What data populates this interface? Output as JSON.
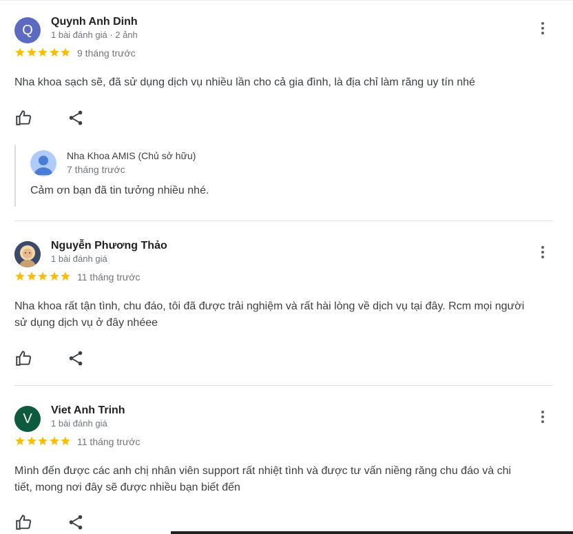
{
  "reviews": [
    {
      "avatar_letter": "Q",
      "avatar_color": "#5c6bc0",
      "name": "Quynh Anh Dinh",
      "meta": "1 bài đánh giá · 2 ảnh",
      "rating": 5,
      "time": "9 tháng trước",
      "text": "Nha khoa sạch sẽ, đã sử dụng dịch vụ nhiều lần cho cả gia đình, là địa chỉ làm răng uy tín nhé",
      "owner_reply": {
        "name": "Nha Khoa AMIS (Chủ sở hữu)",
        "time": "7 tháng trước",
        "text": "Cảm ơn bạn đã tin tưởng nhiều nhé."
      }
    },
    {
      "avatar_letter": "",
      "avatar_color": "#3c4a6b",
      "name": "Nguyễn Phương Thảo",
      "meta": "1 bài đánh giá",
      "rating": 5,
      "time": "11 tháng trước",
      "text_line1": "Nha khoa rất tận tình, chu đáo, tôi đã được trải nghiệm và rất hài lòng về dịch vụ tại đây. Rcm mọi người",
      "text_line2": "sử dụng dịch vụ ở đây nhéee"
    },
    {
      "avatar_letter": "V",
      "avatar_color": "#0d5a3f",
      "name": "Viet Anh Trinh",
      "meta": "1 bài đánh giá",
      "rating": 5,
      "time": "11 tháng trước",
      "text_line1": "Mình đến được các anh chị nhân viên support rất nhiệt tình và được tư vấn niềng răng chu đáo và chi",
      "text_line2": "tiết, mong nơi đây sẽ được nhiều bạn biết đến"
    }
  ],
  "colors": {
    "star": "#fbbc04",
    "icon": "#3c4043",
    "divider": "#dadce0"
  },
  "icons": {
    "like": "thumb-up-icon",
    "share": "share-icon",
    "more": "more-vert-icon",
    "star": "star-icon"
  }
}
